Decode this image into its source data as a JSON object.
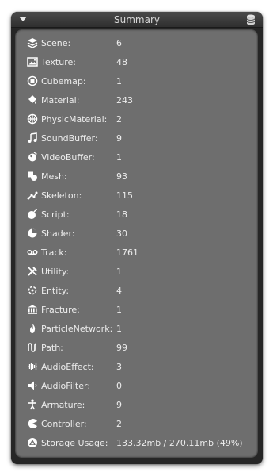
{
  "window": {
    "title": "Summary"
  },
  "rows": [
    {
      "icon": "scene-icon",
      "label": "Scene:",
      "value": "6"
    },
    {
      "icon": "texture-icon",
      "label": "Texture:",
      "value": "48"
    },
    {
      "icon": "cubemap-icon",
      "label": "Cubemap:",
      "value": "1"
    },
    {
      "icon": "material-icon",
      "label": "Material:",
      "value": "243"
    },
    {
      "icon": "physic-material-icon",
      "label": "PhysicMaterial:",
      "value": "2"
    },
    {
      "icon": "sound-buffer-icon",
      "label": "SoundBuffer:",
      "value": "9"
    },
    {
      "icon": "video-buffer-icon",
      "label": "VideoBuffer:",
      "value": "1"
    },
    {
      "icon": "mesh-icon",
      "label": "Mesh:",
      "value": "93"
    },
    {
      "icon": "skeleton-icon",
      "label": "Skeleton:",
      "value": "115"
    },
    {
      "icon": "script-icon",
      "label": "Script:",
      "value": "18"
    },
    {
      "icon": "shader-icon",
      "label": "Shader:",
      "value": "30"
    },
    {
      "icon": "track-icon",
      "label": "Track:",
      "value": "1761"
    },
    {
      "icon": "utility-icon",
      "label": "Utility:",
      "value": "1"
    },
    {
      "icon": "entity-icon",
      "label": "Entity:",
      "value": "4"
    },
    {
      "icon": "fracture-icon",
      "label": "Fracture:",
      "value": "1"
    },
    {
      "icon": "particle-network-icon",
      "label": "ParticleNetwork:",
      "value": "1"
    },
    {
      "icon": "path-icon",
      "label": "Path:",
      "value": "99"
    },
    {
      "icon": "audio-effect-icon",
      "label": "AudioEffect:",
      "value": "3"
    },
    {
      "icon": "audio-filter-icon",
      "label": "AudioFilter:",
      "value": "0"
    },
    {
      "icon": "armature-icon",
      "label": "Armature:",
      "value": "9"
    },
    {
      "icon": "controller-icon",
      "label": "Controller:",
      "value": "2"
    },
    {
      "icon": "storage-icon",
      "label": "Storage Usage:",
      "value": "133.32mb / 270.11mb (49%)"
    }
  ]
}
